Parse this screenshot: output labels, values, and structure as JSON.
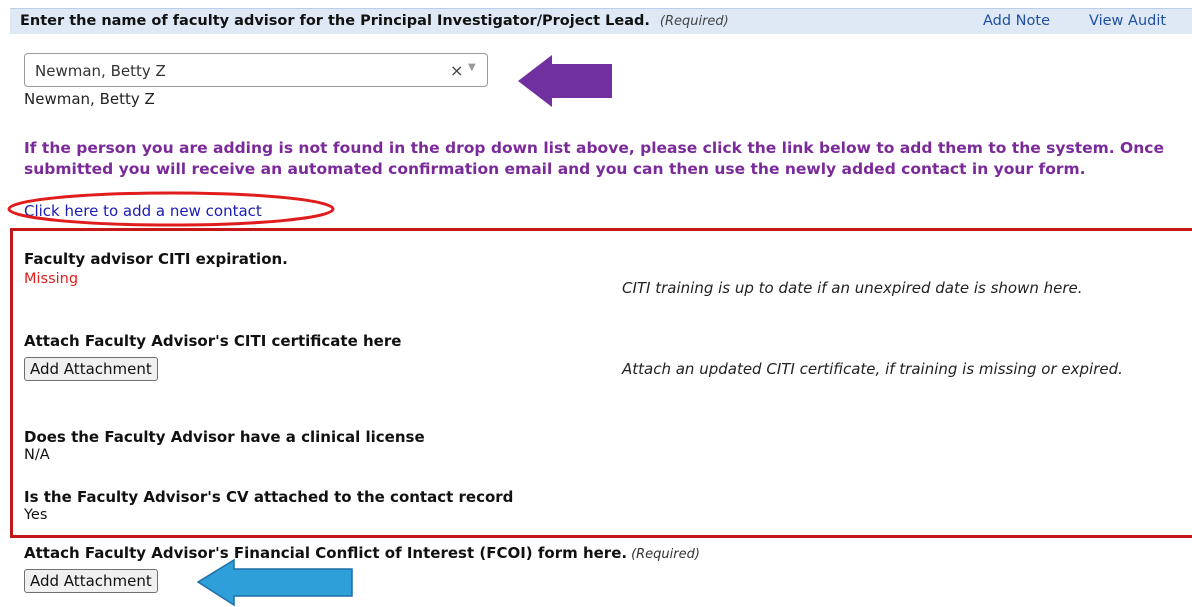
{
  "header": {
    "title": "Enter the name of faculty advisor for the Principal Investigator/Project Lead.",
    "required_label": "(Required)",
    "add_note": "Add Note",
    "view_audit": "View Audit"
  },
  "advisor_select": {
    "value": "Newman, Betty Z",
    "clear_glyph": "×",
    "arrow_glyph": "▼"
  },
  "selected_display": "Newman, Betty Z",
  "info_message": "If the person you are adding is not found in the drop down list above, please click the link below to add them to the system. Once submitted you will receive an automated confirmation email and you can then use the newly added contact in your form.",
  "add_contact_link": "Click here to add a new contact",
  "citi_expiration": {
    "label": "Faculty advisor CITI expiration.",
    "value": "Missing",
    "help": "CITI training is up to date if an unexpired date is shown here."
  },
  "citi_certificate": {
    "label": "Attach Faculty Advisor's CITI certificate here",
    "button": "Add Attachment",
    "help": "Attach an updated CITI certificate, if training is missing or expired."
  },
  "clinical_license": {
    "label": "Does the Faculty Advisor have a clinical license",
    "value": "N/A"
  },
  "cv_attached": {
    "label": "Is the Faculty Advisor's CV attached to the contact record",
    "value": "Yes"
  },
  "fcoi": {
    "label": "Attach Faculty Advisor's Financial Conflict of Interest (FCOI) form here.",
    "required_label": "(Required)",
    "button": "Add Attachment"
  },
  "colors": {
    "annotation_purple": "#7030a0",
    "annotation_blue": "#2e9fd8",
    "annotation_red": "#c41818",
    "info_text": "#7b2a9a"
  }
}
